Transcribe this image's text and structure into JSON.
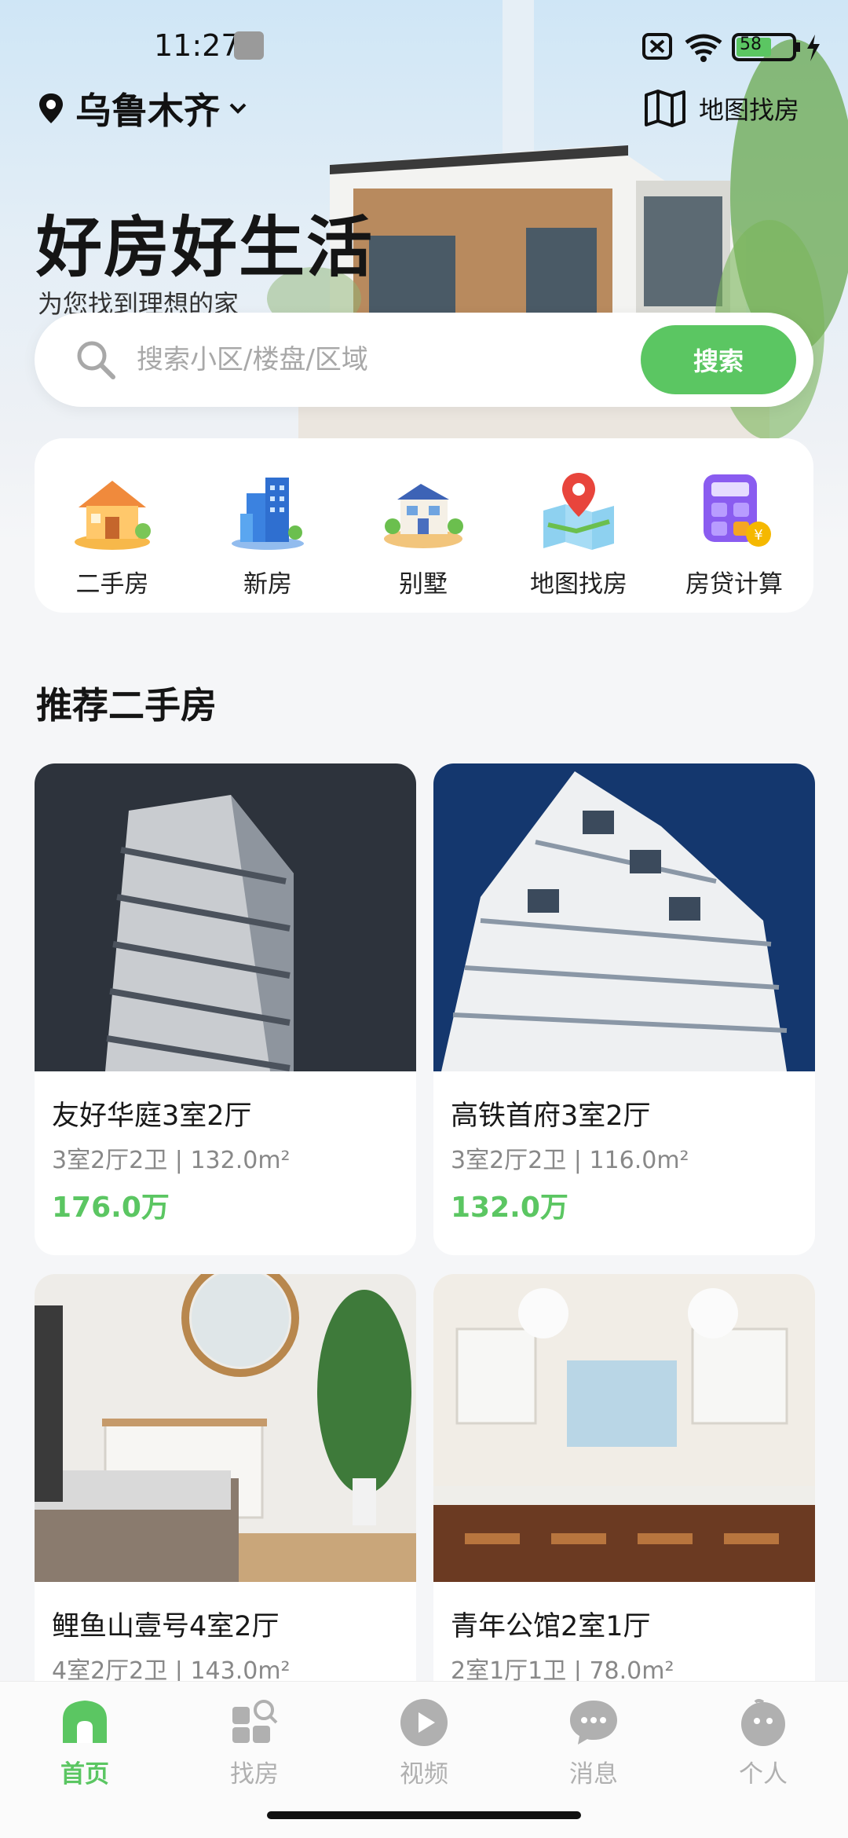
{
  "status_bar": {
    "time": "11:27",
    "battery": "58",
    "icons": [
      "wrench-icon",
      "sim-off-icon",
      "wifi-icon",
      "battery-icon",
      "charging-icon"
    ]
  },
  "header": {
    "city": "乌鲁木齐",
    "location_icon": "location-pin-icon",
    "dropdown_icon": "chevron-down-icon",
    "map_entry_label": "地图找房",
    "map_icon": "map-icon"
  },
  "hero": {
    "title": "好房好生活",
    "subtitle": "为您找到理想的家"
  },
  "search": {
    "placeholder": "搜索小区/楼盘/区域",
    "value": "",
    "button_label": "搜索"
  },
  "quick_actions": [
    {
      "label": "二手房",
      "icon": "house-icon"
    },
    {
      "label": "新房",
      "icon": "building-icon"
    },
    {
      "label": "别墅",
      "icon": "villa-icon"
    },
    {
      "label": "地图找房",
      "icon": "map-pin-icon"
    },
    {
      "label": "房贷计算",
      "icon": "calculator-icon"
    }
  ],
  "recommend": {
    "title": "推荐二手房",
    "listings": [
      {
        "name": "友好华庭3室2厅",
        "specs": "3室2厅2卫 | 132.0m²",
        "price": "176.0万"
      },
      {
        "name": "高铁首府3室2厅",
        "specs": "3室2厅2卫 | 116.0m²",
        "price": "132.0万"
      },
      {
        "name": "鲤鱼山壹号4室2厅",
        "specs": "4室2厅2卫 | 143.0m²",
        "price": ""
      },
      {
        "name": "青年公馆2室1厅",
        "specs": "2室1厅1卫 | 78.0m²",
        "price": ""
      }
    ]
  },
  "tabbar": [
    {
      "label": "首页",
      "icon": "home-icon",
      "active": true
    },
    {
      "label": "找房",
      "icon": "find-house-icon",
      "active": false
    },
    {
      "label": "视频",
      "icon": "video-icon",
      "active": false
    },
    {
      "label": "消息",
      "icon": "message-icon",
      "active": false
    },
    {
      "label": "个人",
      "icon": "profile-icon",
      "active": false
    }
  ],
  "colors": {
    "accent": "#5bc662",
    "background": "#f5f6f8",
    "inactive_tab": "#b0b0b0"
  }
}
